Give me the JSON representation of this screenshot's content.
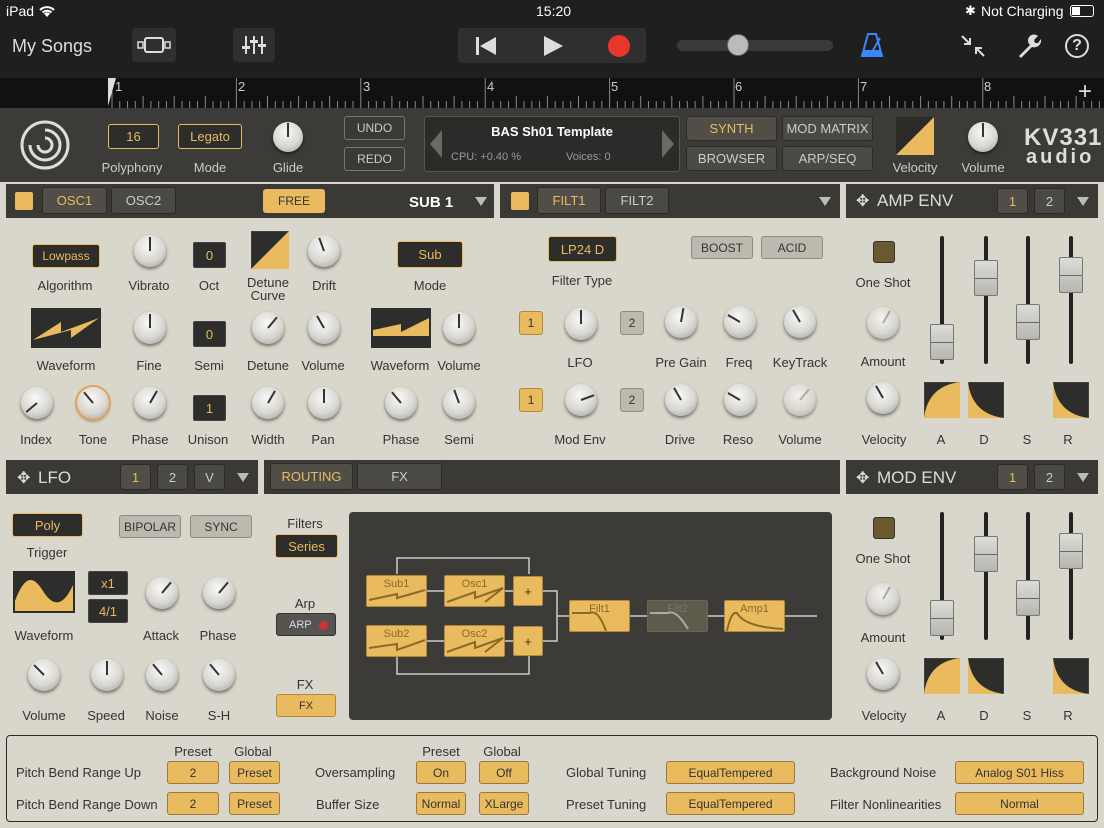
{
  "status": {
    "device": "iPad",
    "time": "15:20",
    "battery": "Not Charging"
  },
  "toolbar": {
    "my_songs": "My Songs"
  },
  "ruler": {
    "bars": [
      "1",
      "2",
      "3",
      "4",
      "5",
      "6",
      "7",
      "8"
    ]
  },
  "header": {
    "polyphony_value": "16",
    "polyphony_label": "Polyphony",
    "mode_value": "Legato",
    "mode_label": "Mode",
    "glide_label": "Glide",
    "undo": "UNDO",
    "redo": "REDO",
    "preset_name": "BAS Sh01 Template",
    "cpu": "CPU: +0.40 %",
    "voices": "Voices: 0",
    "synth": "SYNTH",
    "mod_matrix": "MOD MATRIX",
    "browser": "BROWSER",
    "arp_seq": "ARP/SEQ",
    "velocity_label": "Velocity",
    "volume_label": "Volume",
    "logo_top": "KV331",
    "logo_bottom": "audio"
  },
  "osc": {
    "tab1": "OSC1",
    "tab2": "OSC2",
    "free": "FREE",
    "title": "SUB 1",
    "algorithm_value": "Lowpass",
    "algorithm_label": "Algorithm",
    "vibrato": "Vibrato",
    "oct_value": "0",
    "oct_label": "Oct",
    "detune_curve": "Detune\nCurve",
    "drift": "Drift",
    "mode_value": "Sub",
    "mode_label": "Mode",
    "waveform": "Waveform",
    "fine": "Fine",
    "semi_value": "0",
    "semi_label": "Semi",
    "detune": "Detune",
    "volume": "Volume",
    "sub_waveform": "Waveform",
    "sub_volume": "Volume",
    "index": "Index",
    "tone": "Tone",
    "phase": "Phase",
    "unison_value": "1",
    "unison_label": "Unison",
    "width": "Width",
    "pan": "Pan",
    "sub_phase": "Phase",
    "sub_semi": "Semi"
  },
  "filt": {
    "tab1": "FILT1",
    "tab2": "FILT2",
    "type_value": "LP24 D",
    "type_label": "Filter Type",
    "boost": "BOOST",
    "acid": "ACID",
    "lfo_num1": "1",
    "lfo_num2": "2",
    "lfo": "LFO",
    "pre_gain": "Pre Gain",
    "freq": "Freq",
    "keytrack": "KeyTrack",
    "env_num1": "1",
    "env_num2": "2",
    "mod_env": "Mod Env",
    "drive": "Drive",
    "reso": "Reso",
    "volume": "Volume"
  },
  "amp": {
    "title": "AMP ENV",
    "n1": "1",
    "n2": "2",
    "one_shot": "One Shot",
    "amount": "Amount",
    "velocity": "Velocity",
    "a": "A",
    "d": "D",
    "s": "S",
    "r": "R"
  },
  "lfo": {
    "title": "LFO",
    "n1": "1",
    "n2": "2",
    "v": "V",
    "trigger_value": "Poly",
    "trigger_label": "Trigger",
    "bipolar": "BIPOLAR",
    "sync": "SYNC",
    "x1": "x1",
    "ratio": "4/1",
    "waveform": "Waveform",
    "attack": "Attack",
    "phase": "Phase",
    "volume": "Volume",
    "speed": "Speed",
    "noise": "Noise",
    "sh": "S-H"
  },
  "routing": {
    "tab1": "ROUTING",
    "tab2": "FX",
    "filters_label": "Filters",
    "filters_value": "Series",
    "arp_label": "Arp",
    "arp_btn": "ARP",
    "fx_label": "FX",
    "fx_btn": "FX",
    "sub1": "Sub1",
    "osc1": "Osc1",
    "sub2": "Sub2",
    "osc2": "Osc2",
    "plus": "+",
    "filt1": "Filt1",
    "filt2": "Filt2",
    "amp1": "Amp1"
  },
  "modenv": {
    "title": "MOD ENV",
    "n1": "1",
    "n2": "2",
    "one_shot": "One Shot",
    "amount": "Amount",
    "velocity": "Velocity",
    "a": "A",
    "d": "D",
    "s": "S",
    "r": "R"
  },
  "footer": {
    "preset_h": "Preset",
    "global_h": "Global",
    "preset_h2": "Preset",
    "global_h2": "Global",
    "pb_up": "Pitch Bend Range Up",
    "pb_up_val": "2",
    "pb_up_g": "Preset",
    "pb_down": "Pitch Bend Range Down",
    "pb_down_val": "2",
    "pb_down_g": "Preset",
    "oversampling": "Oversampling",
    "os_p": "On",
    "os_g": "Off",
    "buffer": "Buffer Size",
    "buf_p": "Normal",
    "buf_g": "XLarge",
    "global_tuning": "Global Tuning",
    "gt_val": "EqualTempered",
    "preset_tuning": "Preset Tuning",
    "pt_val": "EqualTempered",
    "bg_noise": "Background Noise",
    "bg_val": "Analog S01 Hiss",
    "filter_nl": "Filter Nonlinearities",
    "fn_val": "Normal"
  }
}
